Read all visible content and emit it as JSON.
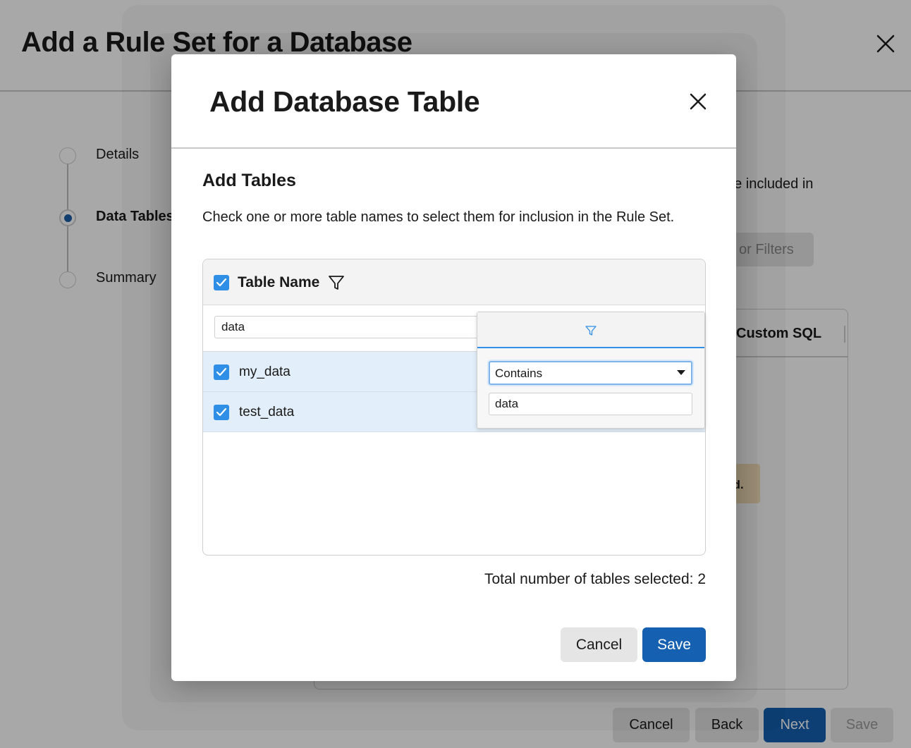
{
  "background": {
    "title": "Add a Rule Set for a Database",
    "steps": [
      {
        "label": "Details"
      },
      {
        "label": "Data Tables"
      },
      {
        "label": "Summary"
      }
    ],
    "side_text": "be included in",
    "filters_button": "or Filters",
    "table_column": "Custom SQL",
    "warning_text": "ed.",
    "footer": {
      "cancel": "Cancel",
      "back": "Back",
      "next": "Next",
      "save": "Save"
    }
  },
  "modal": {
    "title": "Add Database Table",
    "section_title": "Add Tables",
    "instructions": "Check one or more table names to select them for inclusion in the Rule Set.",
    "grid": {
      "column_header": "Table Name",
      "filter_value": "data",
      "rows": [
        {
          "name": "my_data",
          "checked": true
        },
        {
          "name": "test_data",
          "checked": true
        }
      ]
    },
    "filter_popup": {
      "operator": "Contains",
      "value": "data"
    },
    "total_label": "Total number of tables selected: 2",
    "buttons": {
      "cancel": "Cancel",
      "save": "Save"
    }
  },
  "colors": {
    "primary": "#1560b0",
    "checkbox": "#2f8ee5",
    "row_selected": "#e2eefa"
  },
  "icons": {
    "close": "close-icon",
    "filter": "filter-icon",
    "check": "check-icon",
    "dropdown": "caret-down-icon"
  }
}
